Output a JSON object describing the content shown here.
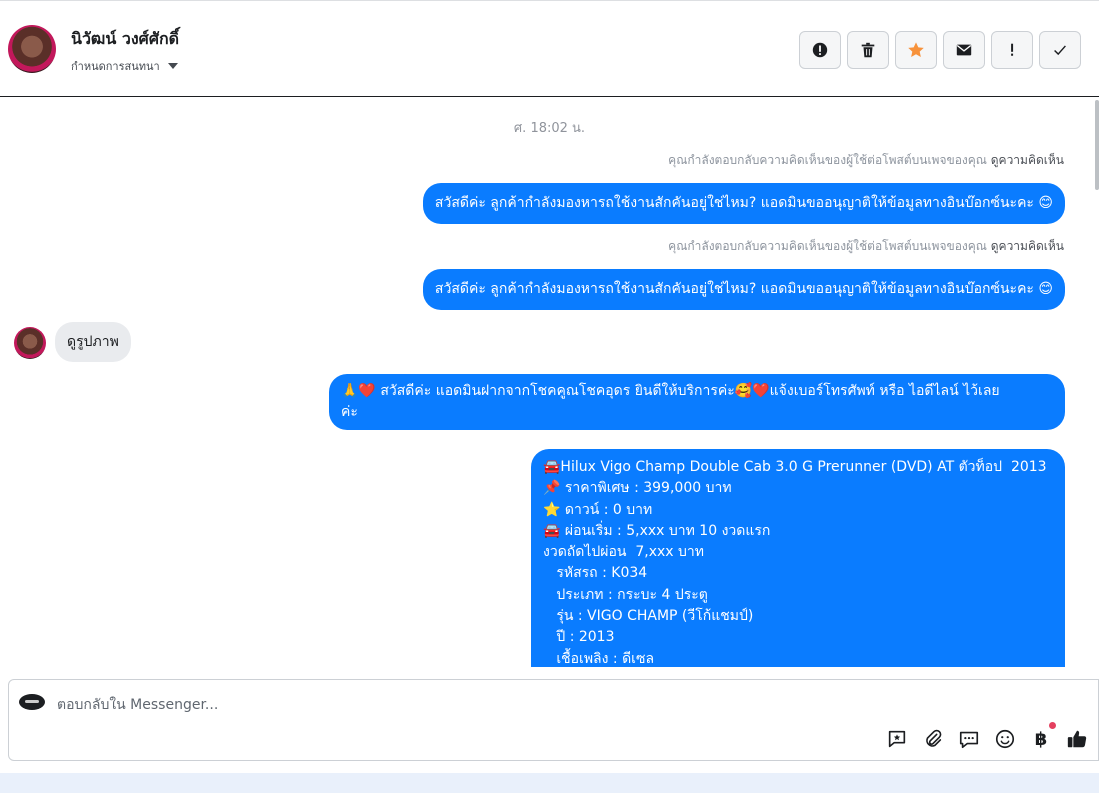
{
  "header": {
    "contact_name": "นิวัฒน์ วงศ์ศักดิ์",
    "manage_label": "กำหนดการสนทนา"
  },
  "actions": [
    {
      "name": "report",
      "icon": "exclamation-circle-icon"
    },
    {
      "name": "delete",
      "icon": "trash-icon"
    },
    {
      "name": "star",
      "icon": "star-icon",
      "color": "#f7923b"
    },
    {
      "name": "mark-unread",
      "icon": "envelope-icon"
    },
    {
      "name": "flag",
      "icon": "exclamation-icon"
    },
    {
      "name": "done",
      "icon": "check-icon"
    }
  ],
  "thread": {
    "timestamp": "ศ. 18:02 น.",
    "sysnote_text": "คุณกำลังตอบกลับความคิดเห็นของผู้ใช้ต่อโพสต์บนเพจของคุณ",
    "sysnote_link": "ดูความคิดเห็น",
    "out1": "สวัสดีค่ะ ลูกค้ากำลังมองหารถใช้งานสักคันอยู่ใช่ไหม? แอดมินขออนุญาติให้ข้อมูลทางอินบ๊อกซ์นะคะ 😊",
    "out2": "สวัสดีค่ะ ลูกค้ากำลังมองหารถใช้งานสักคันอยู่ใช่ไหม? แอดมินขออนุญาติให้ข้อมูลทางอินบ๊อกซ์นะคะ 😊",
    "in1": "ดูรูปภาพ",
    "out3_line1": "🙏❤️ สวัสดีค่ะ แอดมินฝากจากโชคคูณโชคอุดร ยินดีให้บริการค่ะ🥰❤️แจ้งเบอร์โทรศัพท์ หรือ ไอดีไลน์  ไว้เลย",
    "out3_line2": "ค่ะ",
    "listing": "🚘Hilux Vigo Champ Double Cab 3.0 G Prerunner (DVD) AT ตัวท็อป  2013\n📌 ราคาพิเศษ : 399,000 บาท\n⭐ ดาวน์ : 0 บาท\n🚘 ผ่อนเริ่ม : 5,xxx บาท 10 งวดแรก\nงวดถัดไปผ่อน  7,xxx บาท\n   รหัสรถ : K034\n   ประเภท : กระบะ 4 ประตู\n   รุ่น : VIGO CHAMP (วีโก้แชมป์)\n   ปี : 2013\n   เชื้อเพลิง : ดีเซล"
  },
  "composer": {
    "placeholder": "ตอบกลับใน Messenger...",
    "tools": [
      "saved-reply-icon",
      "attachment-icon",
      "chat-bubble-icon",
      "emoji-icon",
      "baht-icon",
      "like-icon"
    ],
    "baht_symbol": "฿"
  }
}
